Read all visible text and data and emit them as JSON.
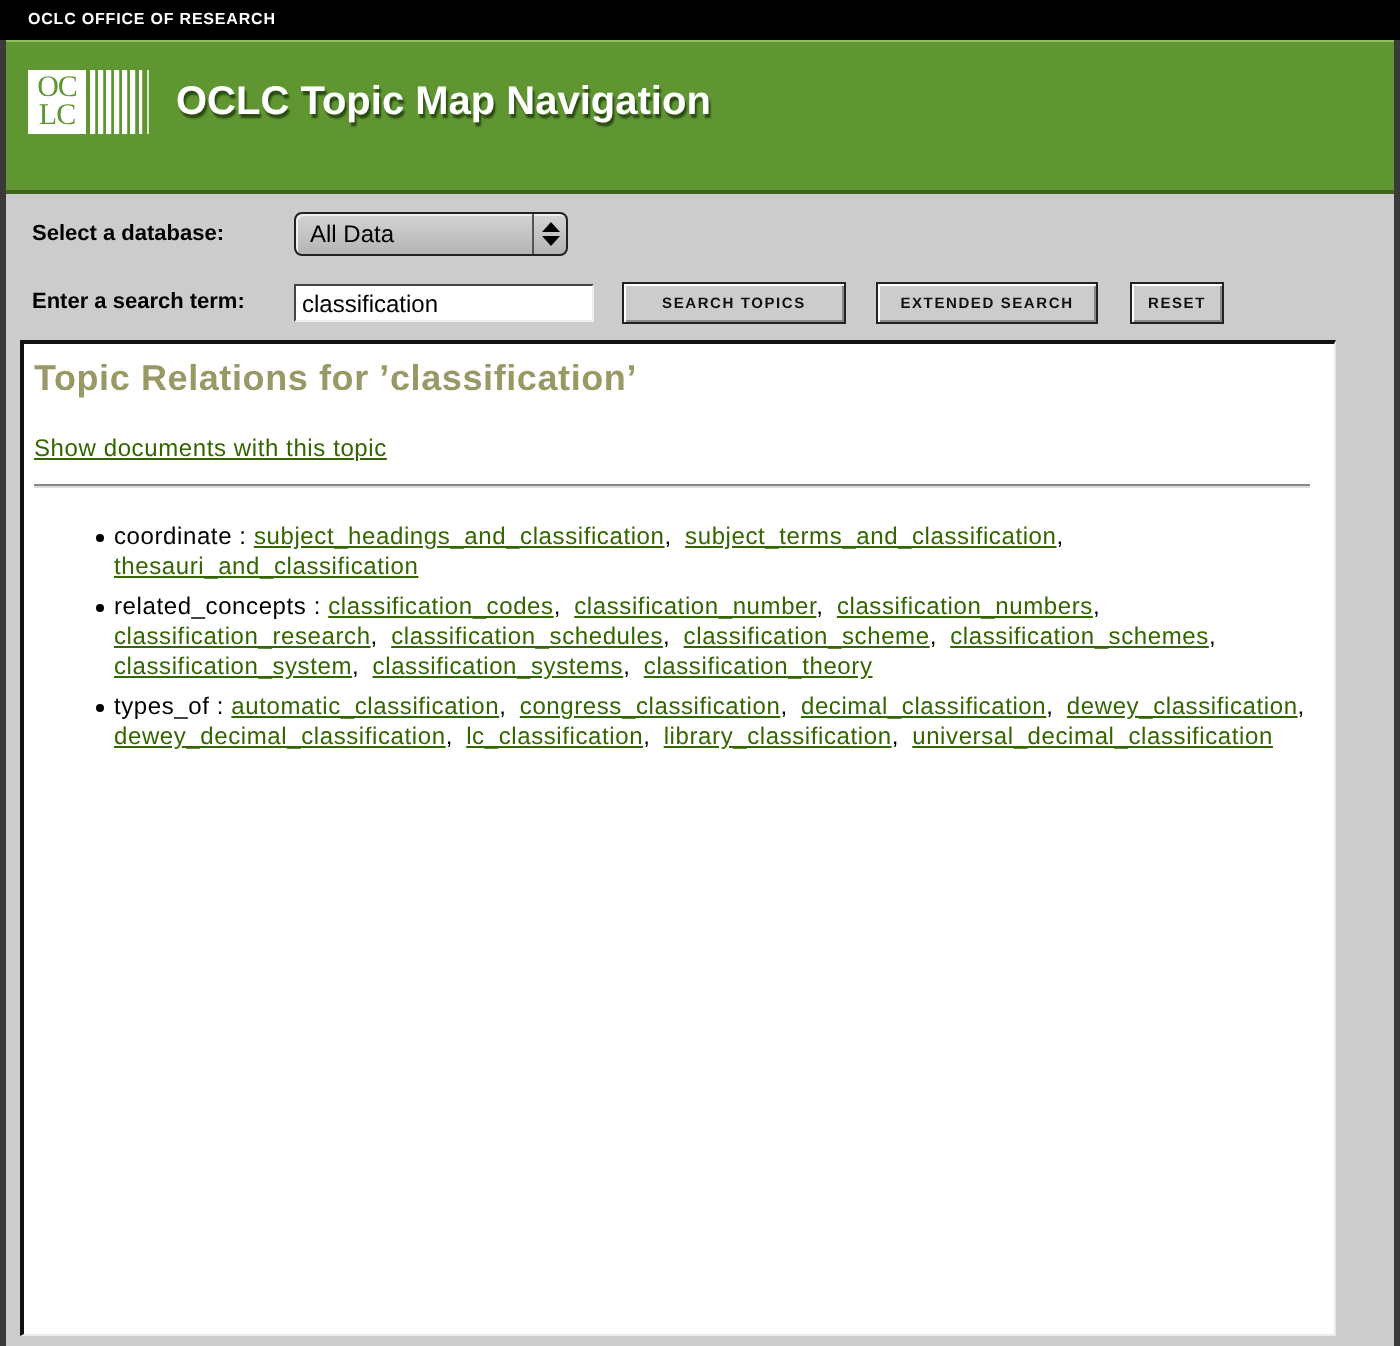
{
  "header": {
    "org": "OCLC OFFICE OF RESEARCH",
    "logo_lines": [
      "OC",
      "LC"
    ],
    "title": "OCLC Topic Map Navigation"
  },
  "form": {
    "database": {
      "label": "Select a database:",
      "value": "All Data"
    },
    "search": {
      "label": "Enter a search term:",
      "value": "classification"
    },
    "buttons": [
      "SEARCH TOPICS",
      "EXTENDED SEARCH",
      "RESET"
    ]
  },
  "results": {
    "heading": "Topic Relations for ’classification’",
    "documents_link": "Show documents with this topic",
    "link_separator": ",",
    "relations": [
      {
        "label": "coordinate :",
        "links": [
          "subject_headings_and_classification",
          "subject_terms_and_classification",
          "thesauri_and_classification"
        ]
      },
      {
        "label": "related_concepts :",
        "links": [
          "classification_codes",
          "classification_number",
          "classification_numbers",
          "classification_research",
          "classification_schedules",
          "classification_scheme",
          "classification_schemes",
          "classification_system",
          "classification_systems",
          "classification_theory"
        ]
      },
      {
        "label": "types_of :",
        "links": [
          "automatic_classification",
          "congress_classification",
          "decimal_classification",
          "dewey_classification",
          "dewey_decimal_classification",
          "lc_classification",
          "library_classification",
          "universal_decimal_classification"
        ]
      }
    ]
  }
}
